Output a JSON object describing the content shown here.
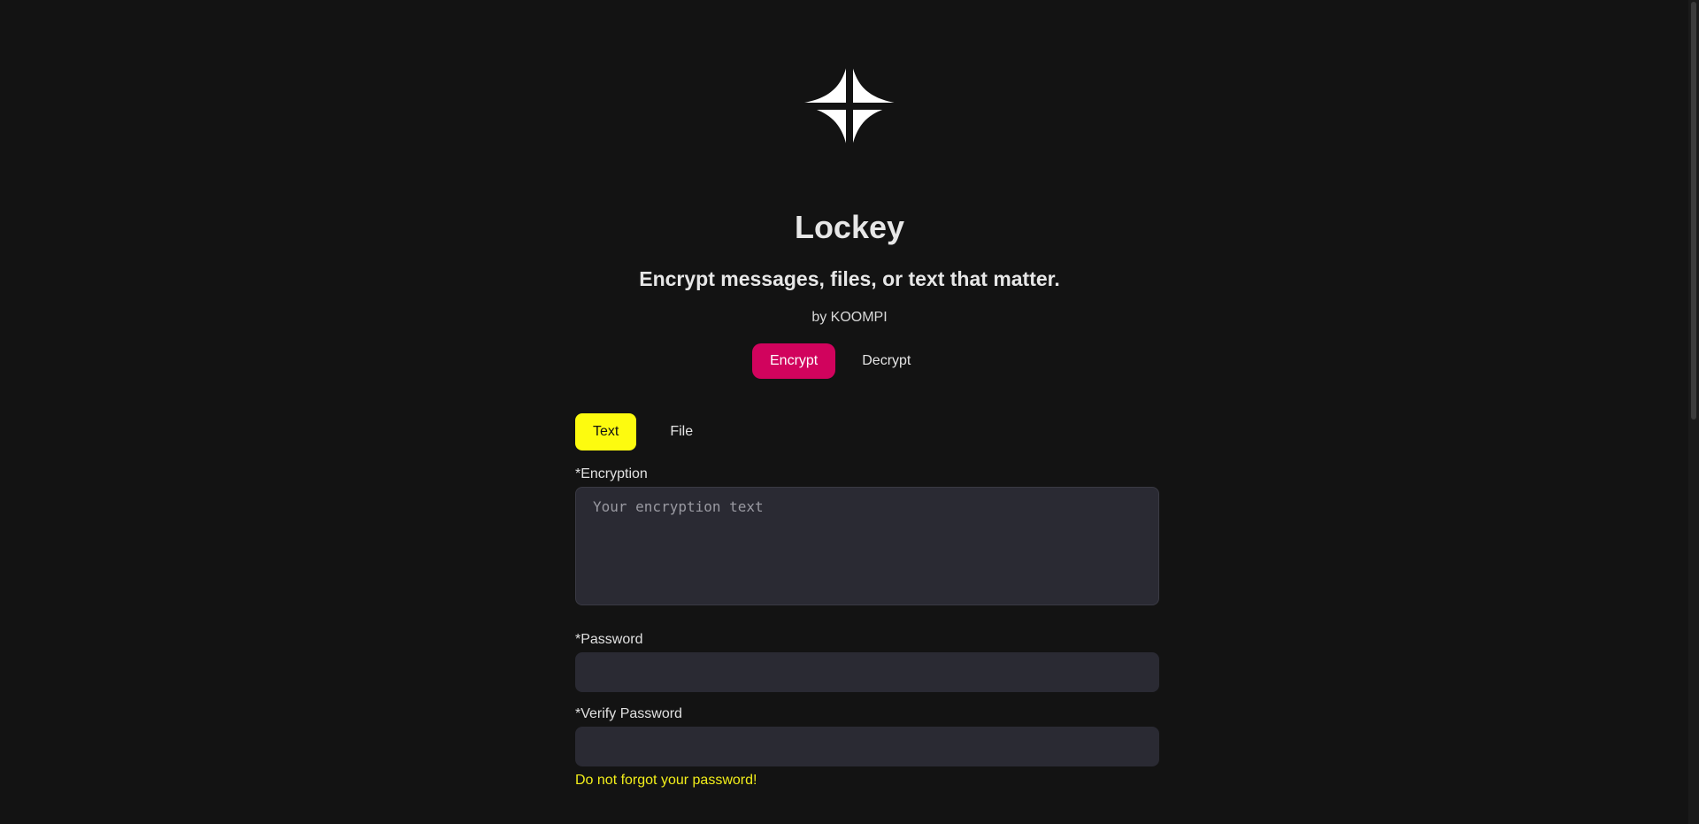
{
  "app": {
    "title": "Lockey",
    "tagline": "Encrypt messages, files, or text that matter.",
    "byline": "by KOOMPI",
    "logo_icon": "four-point-star-icon"
  },
  "mode_tabs": [
    {
      "label": "Encrypt",
      "active": true
    },
    {
      "label": "Decrypt",
      "active": false
    }
  ],
  "type_tabs": [
    {
      "label": "Text",
      "active": true
    },
    {
      "label": "File",
      "active": false
    }
  ],
  "form": {
    "encryption_label": "*Encryption",
    "encryption_placeholder": "Your encryption text",
    "encryption_value": "",
    "password_label": "*Password",
    "password_value": "",
    "verify_label": "*Verify Password",
    "verify_value": "",
    "warning": "Do not forgot your password!"
  },
  "colors": {
    "background": "#131313",
    "encrypt_active": "#d1035d",
    "text_tab_active": "#fdfb0f",
    "input_background": "#2a2a33",
    "warning_text": "#f2ee1a"
  }
}
